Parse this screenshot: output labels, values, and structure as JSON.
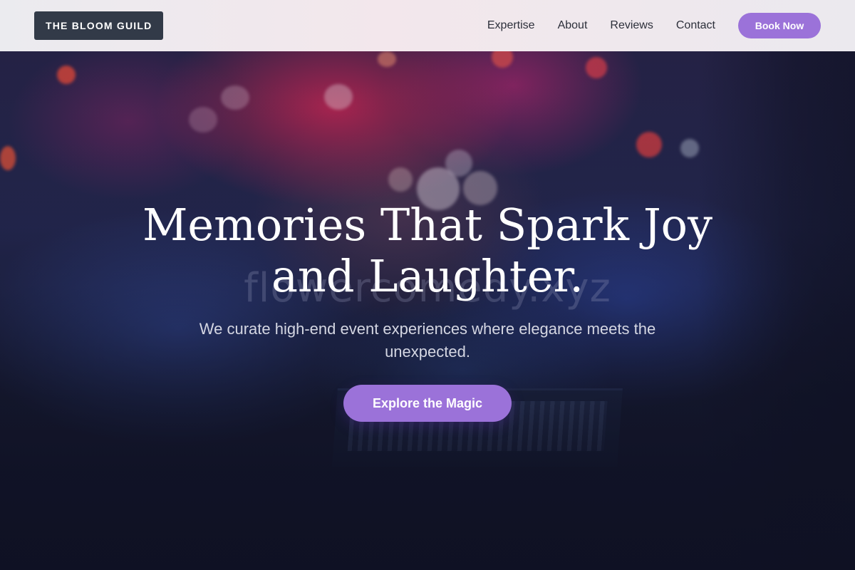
{
  "brand": {
    "name": "THE BLOOM GUILD"
  },
  "nav": {
    "links": [
      "Expertise",
      "About",
      "Reviews",
      "Contact"
    ],
    "cta_label": "Book Now"
  },
  "hero": {
    "headline": "Memories That Spark Joy and Laughter.",
    "subheadline": "We curate high-end event experiences where elegance meets the unexpected.",
    "cta_label": "Explore the Magic",
    "watermark": "flowercomedy.xyz"
  },
  "colors": {
    "accent": "#9b72d9",
    "logo_bg": "#323a48",
    "nav_bg": "#ebebef",
    "hero_overlay": "#14172a",
    "headline_text": "#ffffff"
  }
}
